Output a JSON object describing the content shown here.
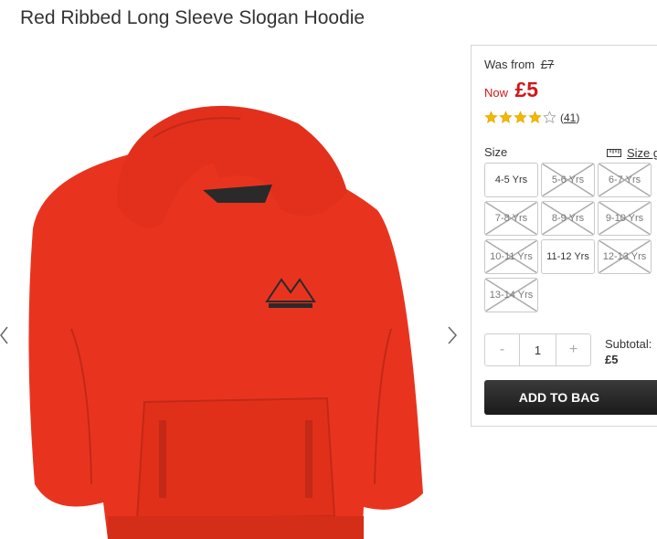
{
  "product": {
    "title": "Red Ribbed Long Sleeve Slogan Hoodie"
  },
  "gallery": {
    "prev_icon": "chevron-left-icon",
    "next_icon": "chevron-right-icon",
    "image_color": "#e8341f"
  },
  "pricing": {
    "was_label": "Was from",
    "was_price": "£7",
    "now_label": "Now",
    "now_price": "£5",
    "sale_color": "#d0181b"
  },
  "rating": {
    "stars": 4,
    "max": 5,
    "count_open": "(",
    "count": "41",
    "count_close": ")"
  },
  "size": {
    "label": "Size",
    "guide_label": "Size g",
    "guide_icon": "ruler-icon",
    "options": [
      {
        "label": "4-5 Yrs",
        "available": true
      },
      {
        "label": "5-6 Yrs",
        "available": false
      },
      {
        "label": "6-7 Yrs",
        "available": false
      },
      {
        "label": "7-8 Yrs",
        "available": false
      },
      {
        "label": "8-9 Yrs",
        "available": false
      },
      {
        "label": "9-10 Yrs",
        "available": false
      },
      {
        "label": "10-11 Yrs",
        "available": false
      },
      {
        "label": "11-12 Yrs",
        "available": true
      },
      {
        "label": "12-13 Yrs",
        "available": false
      },
      {
        "label": "13-14 Yrs",
        "available": false
      }
    ]
  },
  "quantity": {
    "minus_label": "-",
    "value": "1",
    "plus_label": "+"
  },
  "subtotal": {
    "label": "Subtotal:",
    "value": "£5"
  },
  "cart": {
    "add_label": "ADD TO BAG"
  }
}
